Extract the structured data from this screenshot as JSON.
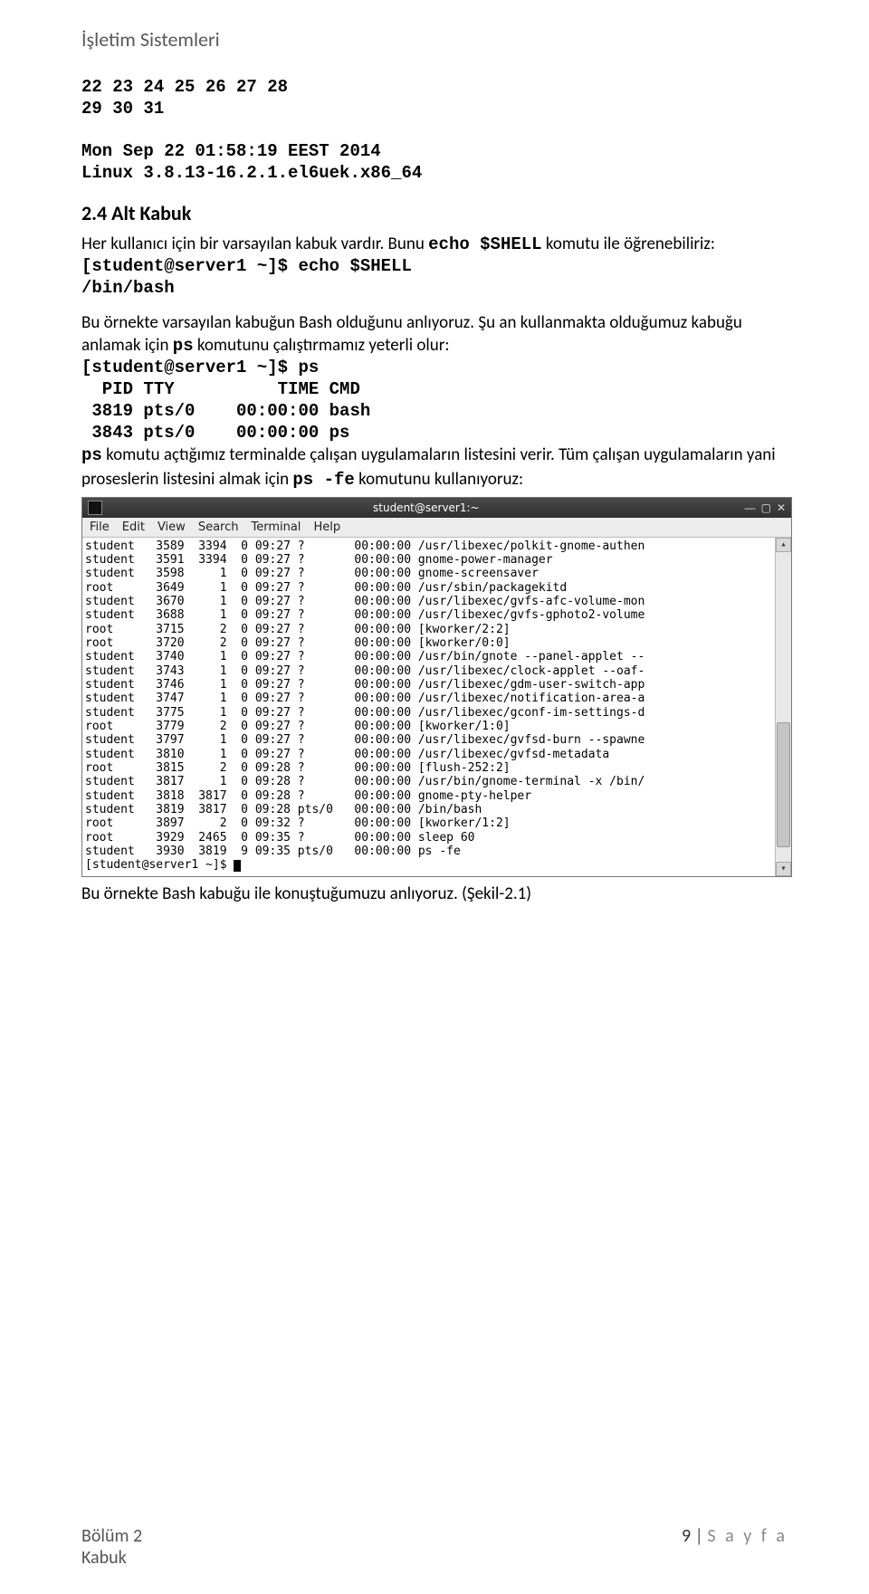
{
  "header": "İşletim Sistemleri",
  "mono_block1": "22 23 24 25 26 27 28\n29 30 31\n\nMon Sep 22 01:58:19 EEST 2014\nLinux 3.8.13-16.2.1.el6uek.x86_64",
  "heading1": "2.4 Alt Kabuk",
  "para1_a": "Her kullanıcı için bir varsayılan kabuk vardır. Bunu ",
  "para1_code": "echo $SHELL",
  "para1_b": " komutu ile öğrenebiliriz:",
  "mono_block2": "[student@server1 ~]$ echo $SHELL\n/bin/bash",
  "para2_a": "Bu örnekte varsayılan kabuğun Bash olduğunu anlıyoruz. Şu an kullanmakta olduğumuz kabuğu anlamak için ",
  "para2_code": "ps",
  "para2_b": " komutunu çalıştırmamız yeterli olur:",
  "mono_block3": "[student@server1 ~]$ ps\n  PID TTY          TIME CMD\n 3819 pts/0    00:00:00 bash\n 3843 pts/0    00:00:00 ps",
  "para3_code1": "ps",
  "para3_a": " komutu açtığımız terminalde çalışan uygulamaların listesini verir. Tüm çalışan uygulamaların yani proseslerin listesini almak için ",
  "para3_code2": "ps -fe",
  "para3_b": " komutunu kullanıyoruz:",
  "terminal": {
    "title": "student@server1:~",
    "menu": [
      "File",
      "Edit",
      "View",
      "Search",
      "Terminal",
      "Help"
    ],
    "rows": [
      [
        "student",
        "3589",
        "3394",
        "0",
        "09:27",
        "?",
        "00:00:00",
        "/usr/libexec/polkit-gnome-authen"
      ],
      [
        "student",
        "3591",
        "3394",
        "0",
        "09:27",
        "?",
        "00:00:00",
        "gnome-power-manager"
      ],
      [
        "student",
        "3598",
        "1",
        "0",
        "09:27",
        "?",
        "00:00:00",
        "gnome-screensaver"
      ],
      [
        "root",
        "3649",
        "1",
        "0",
        "09:27",
        "?",
        "00:00:00",
        "/usr/sbin/packagekitd"
      ],
      [
        "student",
        "3670",
        "1",
        "0",
        "09:27",
        "?",
        "00:00:00",
        "/usr/libexec/gvfs-afc-volume-mon"
      ],
      [
        "student",
        "3688",
        "1",
        "0",
        "09:27",
        "?",
        "00:00:00",
        "/usr/libexec/gvfs-gphoto2-volume"
      ],
      [
        "root",
        "3715",
        "2",
        "0",
        "09:27",
        "?",
        "00:00:00",
        "[kworker/2:2]"
      ],
      [
        "root",
        "3720",
        "2",
        "0",
        "09:27",
        "?",
        "00:00:00",
        "[kworker/0:0]"
      ],
      [
        "student",
        "3740",
        "1",
        "0",
        "09:27",
        "?",
        "00:00:00",
        "/usr/bin/gnote --panel-applet --"
      ],
      [
        "student",
        "3743",
        "1",
        "0",
        "09:27",
        "?",
        "00:00:00",
        "/usr/libexec/clock-applet --oaf-"
      ],
      [
        "student",
        "3746",
        "1",
        "0",
        "09:27",
        "?",
        "00:00:00",
        "/usr/libexec/gdm-user-switch-app"
      ],
      [
        "student",
        "3747",
        "1",
        "0",
        "09:27",
        "?",
        "00:00:00",
        "/usr/libexec/notification-area-a"
      ],
      [
        "student",
        "3775",
        "1",
        "0",
        "09:27",
        "?",
        "00:00:00",
        "/usr/libexec/gconf-im-settings-d"
      ],
      [
        "root",
        "3779",
        "2",
        "0",
        "09:27",
        "?",
        "00:00:00",
        "[kworker/1:0]"
      ],
      [
        "student",
        "3797",
        "1",
        "0",
        "09:27",
        "?",
        "00:00:00",
        "/usr/libexec/gvfsd-burn --spawne"
      ],
      [
        "student",
        "3810",
        "1",
        "0",
        "09:27",
        "?",
        "00:00:00",
        "/usr/libexec/gvfsd-metadata"
      ],
      [
        "root",
        "3815",
        "2",
        "0",
        "09:28",
        "?",
        "00:00:00",
        "[flush-252:2]"
      ],
      [
        "student",
        "3817",
        "1",
        "0",
        "09:28",
        "?",
        "00:00:00",
        "/usr/bin/gnome-terminal -x /bin/"
      ],
      [
        "student",
        "3818",
        "3817",
        "0",
        "09:28",
        "?",
        "00:00:00",
        "gnome-pty-helper"
      ],
      [
        "student",
        "3819",
        "3817",
        "0",
        "09:28",
        "pts/0",
        "00:00:00",
        "/bin/bash"
      ],
      [
        "root",
        "3897",
        "2",
        "0",
        "09:32",
        "?",
        "00:00:00",
        "[kworker/1:2]"
      ],
      [
        "root",
        "3929",
        "2465",
        "0",
        "09:35",
        "?",
        "00:00:00",
        "sleep 60"
      ],
      [
        "student",
        "3930",
        "3819",
        "9",
        "09:35",
        "pts/0",
        "00:00:00",
        "ps -fe"
      ]
    ],
    "prompt": "[student@server1 ~]$ "
  },
  "para4": "Bu örnekte Bash kabuğu ile konuştuğumuzu anlıyoruz. (Şekil-2.1)",
  "footer": {
    "left_line1": "Bölüm 2",
    "left_line2": "Kabuk",
    "pagenum": "9",
    "pagelabel": "S a y f a"
  }
}
